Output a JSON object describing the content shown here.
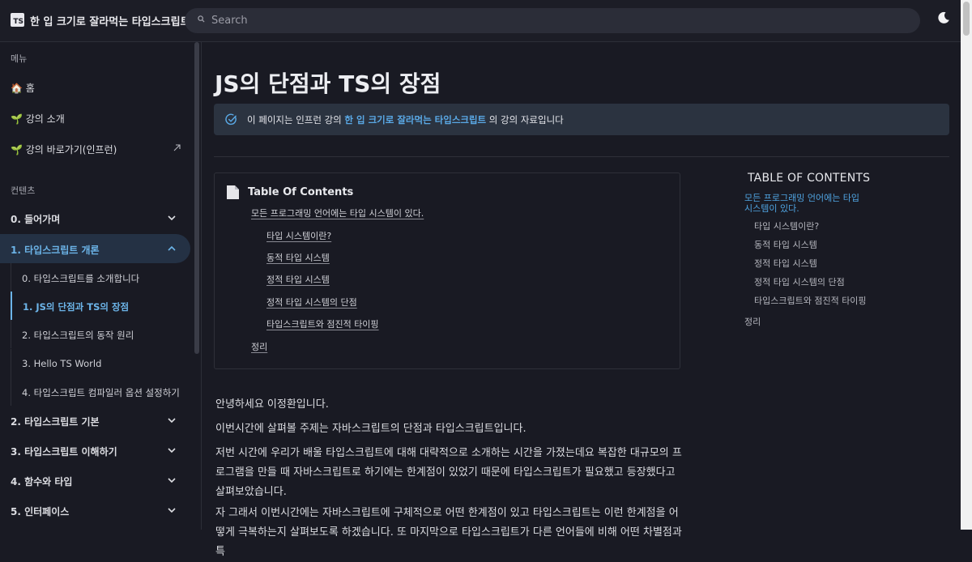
{
  "header": {
    "logo_text": "TS",
    "site_title": "한 입 크기로 잘라먹는 타입스크립트",
    "search_placeholder": "Search"
  },
  "sidebar": {
    "menu_title": "메뉴",
    "menu_items": [
      {
        "label": "🏠 홈"
      },
      {
        "label": "🌱 강의 소개"
      },
      {
        "label": "🌱 강의 바로가기(인프런)"
      }
    ],
    "contents_title": "컨텐츠",
    "sections": [
      {
        "label": "0. 들어가며"
      },
      {
        "label": "1. 타입스크립트 개론"
      },
      {
        "label": "2. 타입스크립트 기본"
      },
      {
        "label": "3. 타입스크립트 이해하기"
      },
      {
        "label": "4. 함수와 타입"
      },
      {
        "label": "5. 인터페이스"
      }
    ],
    "sub_items": [
      {
        "label": "0. 타입스크립트를 소개합니다"
      },
      {
        "label": "1. JS의 단점과 TS의 장점"
      },
      {
        "label": "2. 타입스크립트의 동작 원리"
      },
      {
        "label": "3. Hello TS World"
      },
      {
        "label": "4. 타입스크립트 컴파일러 옵션 설정하기"
      }
    ]
  },
  "main": {
    "title": "JS의 단점과 TS의 장점",
    "notice": {
      "before": "이 페이지는 인프런 강의 ",
      "link": "한 입 크기로 잘라먹는 타입스크립트",
      "after": " 의 강의 자료입니다"
    },
    "toc_title": "Table Of Contents",
    "toc": [
      "모든 프로그래밍 언어에는 타입 시스템이 있다.",
      "타입 시스템이란?",
      "동적 타입 시스템",
      "정적 타입 시스템",
      "정적 타입 시스템의 단점",
      "타입스크립트와 점진적 타이핑",
      "정리"
    ],
    "paragraphs": [
      "안녕하세요 이정환입니다.",
      "이번시간에 살펴볼 주제는 자바스크립트의 단점과 타입스크립트입니다.",
      "저번 시간에 우리가 배울 타입스크립트에 대해 대략적으로 소개하는 시간을 가졌는데요 복잡한 대규모의 프로그램을 만들 때 자바스크립트로 하기에는 한계점이 있었기 때문에 타입스크립트가 필요했고 등장했다고 살펴보았습니다.",
      "자 그래서 이번시간에는 자바스크립트에 구체적으로 어떤 한계점이 있고 타입스크립트는 이런 한계점을 어떻게 극복하는지 살펴보도록 하겠습니다. 또 마지막으로 타입스크립트가 다른 언어들에 비해 어떤 차별점과 특"
    ]
  },
  "right_toc": {
    "title": "TABLE OF CONTENTS",
    "items": [
      "모든 프로그래밍 언어에는 타입 시스템이 있다.",
      "타입 시스템이란?",
      "동적 타입 시스템",
      "정적 타입 시스템",
      "정적 타입 시스템의 단점",
      "타입스크립트와 점진적 타이핑",
      "정리"
    ]
  },
  "colors": {
    "background": "#191a23",
    "accent": "#5aa9e6",
    "active_bg": "#243144"
  }
}
